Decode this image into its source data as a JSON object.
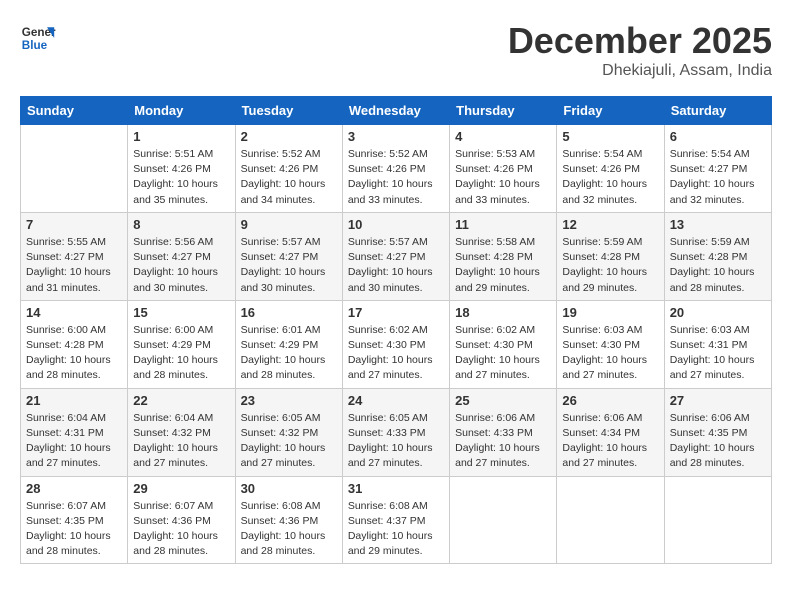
{
  "header": {
    "logo_line1": "General",
    "logo_line2": "Blue",
    "month": "December 2025",
    "location": "Dhekiajuli, Assam, India"
  },
  "weekdays": [
    "Sunday",
    "Monday",
    "Tuesday",
    "Wednesday",
    "Thursday",
    "Friday",
    "Saturday"
  ],
  "weeks": [
    [
      {
        "day": "",
        "info": ""
      },
      {
        "day": "1",
        "info": "Sunrise: 5:51 AM\nSunset: 4:26 PM\nDaylight: 10 hours\nand 35 minutes."
      },
      {
        "day": "2",
        "info": "Sunrise: 5:52 AM\nSunset: 4:26 PM\nDaylight: 10 hours\nand 34 minutes."
      },
      {
        "day": "3",
        "info": "Sunrise: 5:52 AM\nSunset: 4:26 PM\nDaylight: 10 hours\nand 33 minutes."
      },
      {
        "day": "4",
        "info": "Sunrise: 5:53 AM\nSunset: 4:26 PM\nDaylight: 10 hours\nand 33 minutes."
      },
      {
        "day": "5",
        "info": "Sunrise: 5:54 AM\nSunset: 4:26 PM\nDaylight: 10 hours\nand 32 minutes."
      },
      {
        "day": "6",
        "info": "Sunrise: 5:54 AM\nSunset: 4:27 PM\nDaylight: 10 hours\nand 32 minutes."
      }
    ],
    [
      {
        "day": "7",
        "info": "Sunrise: 5:55 AM\nSunset: 4:27 PM\nDaylight: 10 hours\nand 31 minutes."
      },
      {
        "day": "8",
        "info": "Sunrise: 5:56 AM\nSunset: 4:27 PM\nDaylight: 10 hours\nand 30 minutes."
      },
      {
        "day": "9",
        "info": "Sunrise: 5:57 AM\nSunset: 4:27 PM\nDaylight: 10 hours\nand 30 minutes."
      },
      {
        "day": "10",
        "info": "Sunrise: 5:57 AM\nSunset: 4:27 PM\nDaylight: 10 hours\nand 30 minutes."
      },
      {
        "day": "11",
        "info": "Sunrise: 5:58 AM\nSunset: 4:28 PM\nDaylight: 10 hours\nand 29 minutes."
      },
      {
        "day": "12",
        "info": "Sunrise: 5:59 AM\nSunset: 4:28 PM\nDaylight: 10 hours\nand 29 minutes."
      },
      {
        "day": "13",
        "info": "Sunrise: 5:59 AM\nSunset: 4:28 PM\nDaylight: 10 hours\nand 28 minutes."
      }
    ],
    [
      {
        "day": "14",
        "info": "Sunrise: 6:00 AM\nSunset: 4:28 PM\nDaylight: 10 hours\nand 28 minutes."
      },
      {
        "day": "15",
        "info": "Sunrise: 6:00 AM\nSunset: 4:29 PM\nDaylight: 10 hours\nand 28 minutes."
      },
      {
        "day": "16",
        "info": "Sunrise: 6:01 AM\nSunset: 4:29 PM\nDaylight: 10 hours\nand 28 minutes."
      },
      {
        "day": "17",
        "info": "Sunrise: 6:02 AM\nSunset: 4:30 PM\nDaylight: 10 hours\nand 27 minutes."
      },
      {
        "day": "18",
        "info": "Sunrise: 6:02 AM\nSunset: 4:30 PM\nDaylight: 10 hours\nand 27 minutes."
      },
      {
        "day": "19",
        "info": "Sunrise: 6:03 AM\nSunset: 4:30 PM\nDaylight: 10 hours\nand 27 minutes."
      },
      {
        "day": "20",
        "info": "Sunrise: 6:03 AM\nSunset: 4:31 PM\nDaylight: 10 hours\nand 27 minutes."
      }
    ],
    [
      {
        "day": "21",
        "info": "Sunrise: 6:04 AM\nSunset: 4:31 PM\nDaylight: 10 hours\nand 27 minutes."
      },
      {
        "day": "22",
        "info": "Sunrise: 6:04 AM\nSunset: 4:32 PM\nDaylight: 10 hours\nand 27 minutes."
      },
      {
        "day": "23",
        "info": "Sunrise: 6:05 AM\nSunset: 4:32 PM\nDaylight: 10 hours\nand 27 minutes."
      },
      {
        "day": "24",
        "info": "Sunrise: 6:05 AM\nSunset: 4:33 PM\nDaylight: 10 hours\nand 27 minutes."
      },
      {
        "day": "25",
        "info": "Sunrise: 6:06 AM\nSunset: 4:33 PM\nDaylight: 10 hours\nand 27 minutes."
      },
      {
        "day": "26",
        "info": "Sunrise: 6:06 AM\nSunset: 4:34 PM\nDaylight: 10 hours\nand 27 minutes."
      },
      {
        "day": "27",
        "info": "Sunrise: 6:06 AM\nSunset: 4:35 PM\nDaylight: 10 hours\nand 28 minutes."
      }
    ],
    [
      {
        "day": "28",
        "info": "Sunrise: 6:07 AM\nSunset: 4:35 PM\nDaylight: 10 hours\nand 28 minutes."
      },
      {
        "day": "29",
        "info": "Sunrise: 6:07 AM\nSunset: 4:36 PM\nDaylight: 10 hours\nand 28 minutes."
      },
      {
        "day": "30",
        "info": "Sunrise: 6:08 AM\nSunset: 4:36 PM\nDaylight: 10 hours\nand 28 minutes."
      },
      {
        "day": "31",
        "info": "Sunrise: 6:08 AM\nSunset: 4:37 PM\nDaylight: 10 hours\nand 29 minutes."
      },
      {
        "day": "",
        "info": ""
      },
      {
        "day": "",
        "info": ""
      },
      {
        "day": "",
        "info": ""
      }
    ]
  ]
}
